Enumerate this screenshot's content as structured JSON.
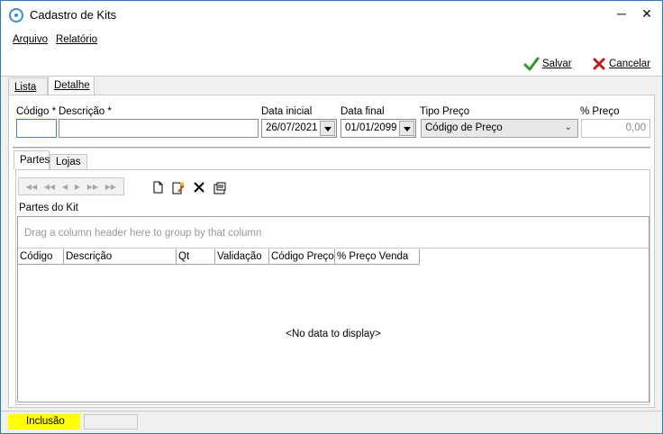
{
  "window": {
    "title": "Cadastro de Kits",
    "minimize_glyph": "─",
    "close_glyph": "✕"
  },
  "menu": {
    "items": [
      {
        "label": "Arquivo"
      },
      {
        "label": "Relatório"
      }
    ]
  },
  "toolbar": {
    "save_label": "Salvar",
    "save_icon": "check-icon",
    "cancel_label": "Cancelar",
    "cancel_icon": "x-icon",
    "save_color": "#2a9a2a",
    "cancel_color": "#b81c1c"
  },
  "tabs": [
    {
      "label": "Lista"
    },
    {
      "label": "Detalhe",
      "active": true
    }
  ],
  "form": {
    "codigo_label": "Código *",
    "codigo_value": "",
    "descricao_label": "Descrição *",
    "descricao_value": "",
    "data_inicial_label": "Data inicial",
    "data_inicial_value": "26/07/2021",
    "data_final_label": "Data final",
    "data_final_value": "01/01/2099",
    "tipo_preco_label": "Tipo Preço",
    "tipo_preco_value": "Código de Preço",
    "perc_preco_label": "% Preço",
    "perc_preco_value": "0,00"
  },
  "inner_tabs": [
    {
      "label": "Partes",
      "active": true
    },
    {
      "label": "Lojas"
    }
  ],
  "grid": {
    "caption": "Partes do Kit",
    "group_hint": "Drag a column header here to group by that column",
    "columns": [
      "Código",
      "Descrição",
      "Qt",
      "Validação",
      "Código Preço",
      "% Preço Venda"
    ],
    "empty_text": "<No data to display>"
  },
  "status": {
    "mode": "Inclusão",
    "mode_color": "#ffff00"
  }
}
